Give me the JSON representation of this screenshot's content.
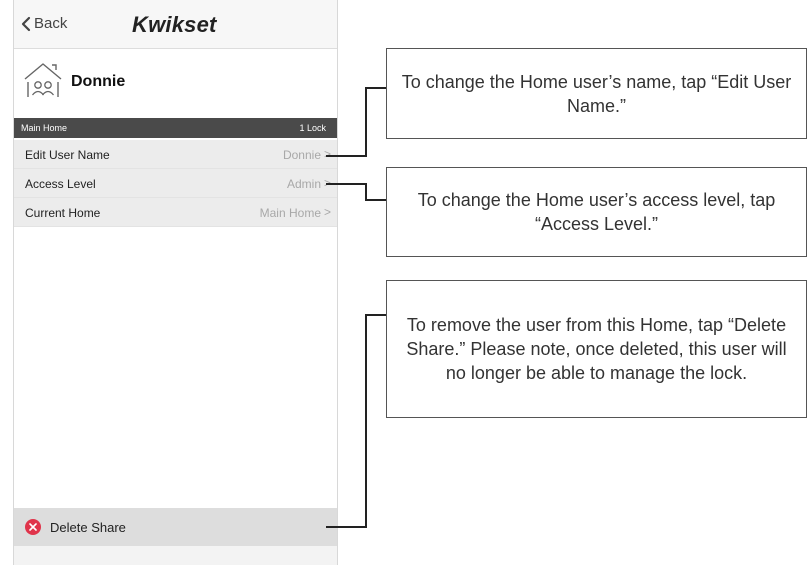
{
  "app": {
    "back_label": "Back",
    "brand": "Kwikset"
  },
  "user": {
    "name": "Donnie"
  },
  "section": {
    "title": "Main Home",
    "count": "1 Lock"
  },
  "rows": [
    {
      "label": "Edit User Name",
      "value": "Donnie",
      "chevron": ">"
    },
    {
      "label": "Access Level",
      "value": "Admin",
      "chevron": ">"
    },
    {
      "label": "Current Home",
      "value": "Main Home",
      "chevron": ">"
    }
  ],
  "delete": {
    "label": "Delete Share",
    "icon": "close-circle-icon",
    "color": "#e0344b"
  },
  "callouts": [
    "To change the Home user’s name, tap “Edit User Name.”",
    "To change the Home user’s access level, tap “Access Level.”",
    "To remove the user from this Home, tap “Delete Share.” Please note, once deleted, this user will no longer be able to manage the lock."
  ]
}
